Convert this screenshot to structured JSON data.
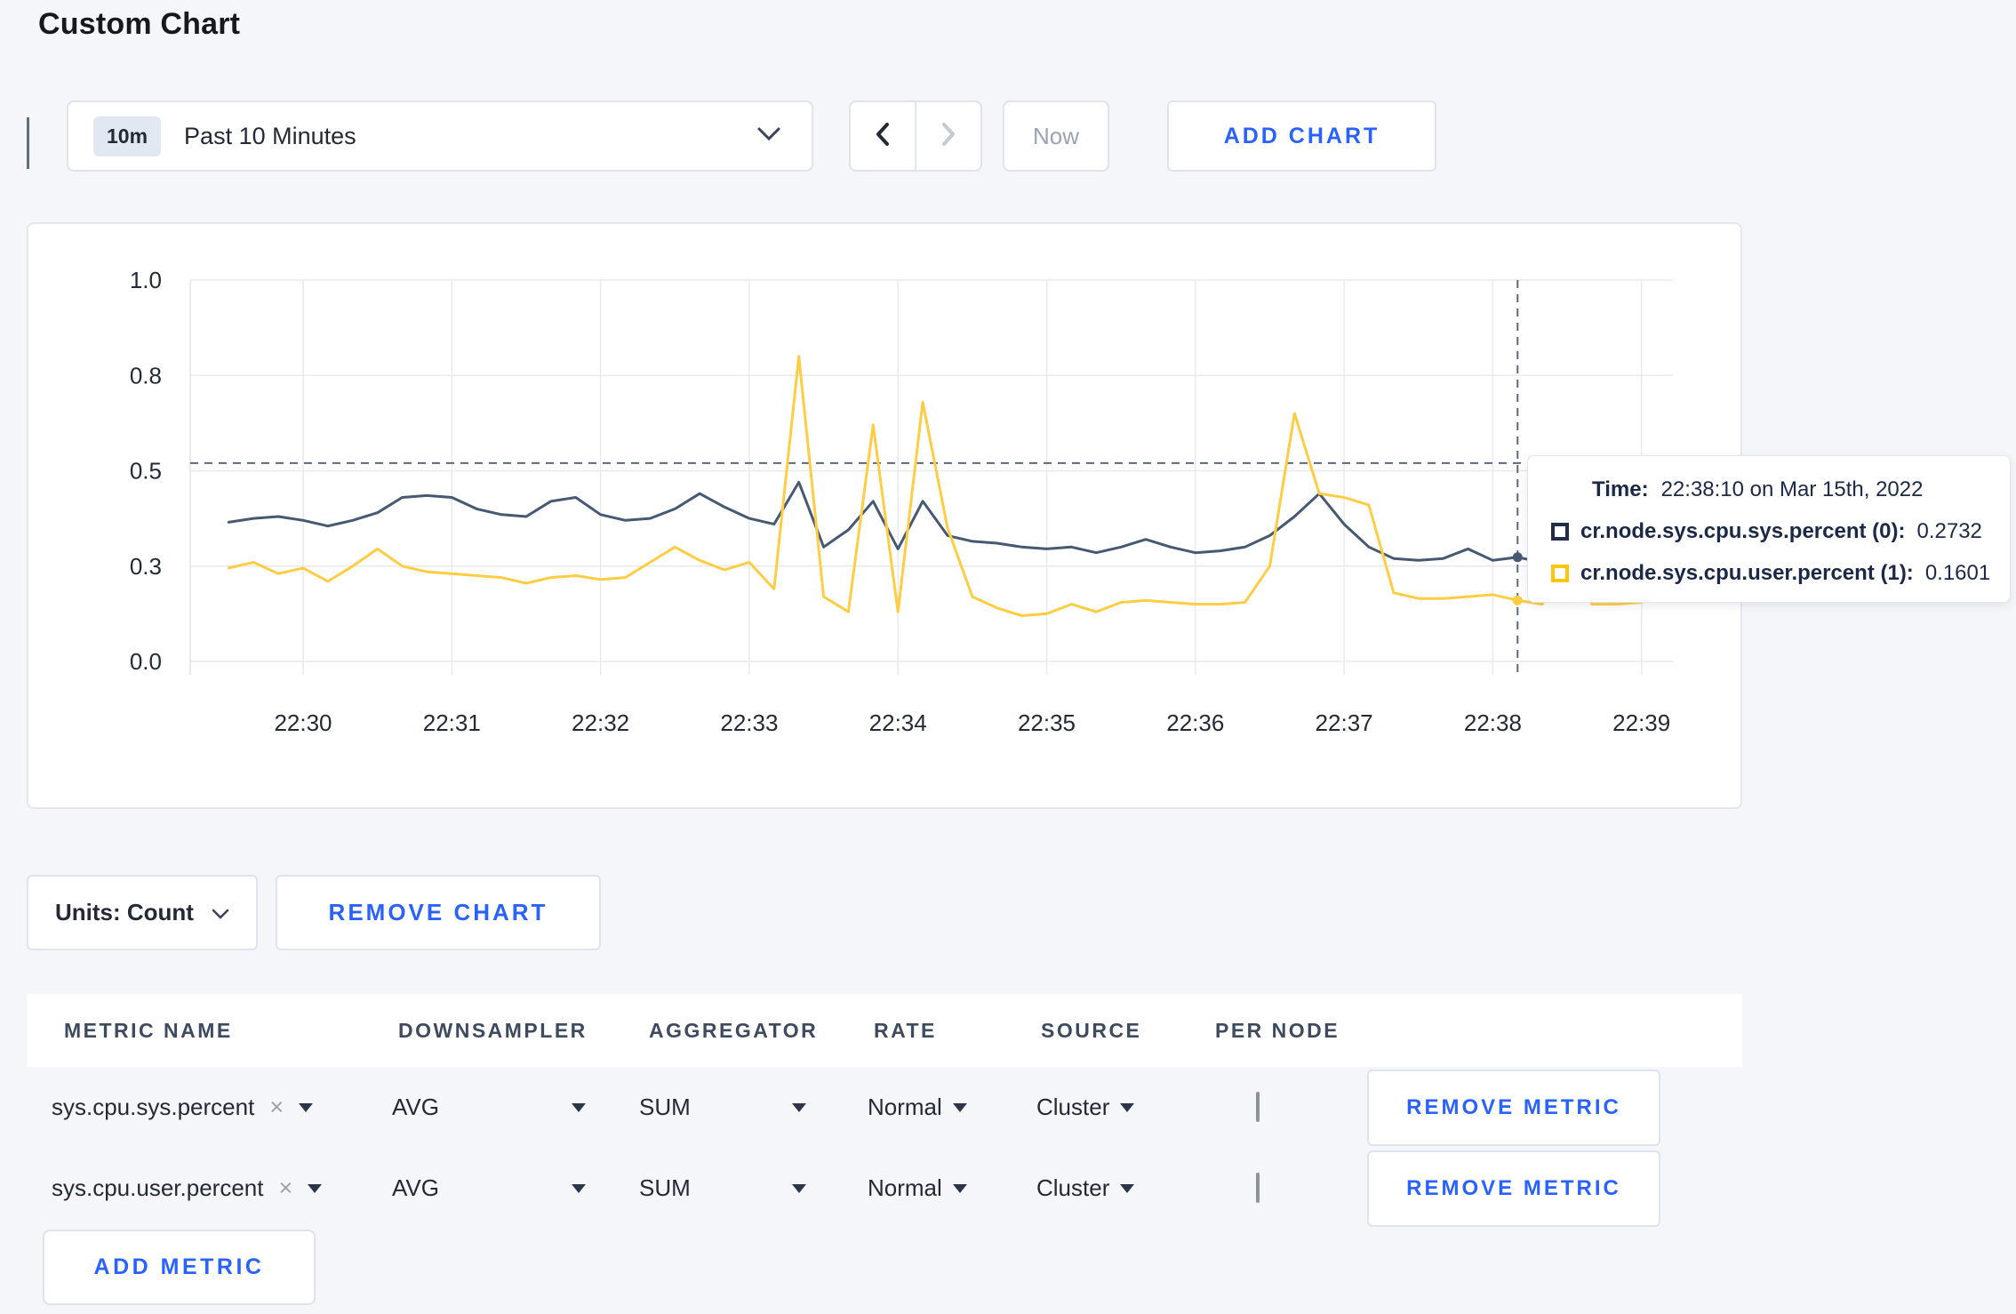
{
  "page": {
    "title": "Custom Chart"
  },
  "toolbar": {
    "time_selector": {
      "badge": "10m",
      "selected": "Past 10 Minutes"
    },
    "now_button": "Now",
    "add_chart_button": "ADD CHART"
  },
  "chart_data": {
    "type": "line",
    "title": "",
    "xlabel": "",
    "ylabel": "",
    "ylim": [
      0,
      1
    ],
    "grid": true,
    "legend_position": "tooltip-only",
    "x_ticks": [
      "22:30",
      "22:31",
      "22:32",
      "22:33",
      "22:34",
      "22:35",
      "22:36",
      "22:37",
      "22:38",
      "22:39"
    ],
    "y_ticks": [
      {
        "label": "0.0",
        "value": 0
      },
      {
        "label": "0.3",
        "value": 0.25
      },
      {
        "label": "0.5",
        "value": 0.5
      },
      {
        "label": "0.8",
        "value": 0.75
      },
      {
        "label": "1.0",
        "value": 1
      }
    ],
    "x_start_offset_minutes": -0.5,
    "x_step_minutes": 0.1666667,
    "series": [
      {
        "name": "cr.node.sys.cpu.sys.percent (0)",
        "color": "#475872",
        "values": [
          0.365,
          0.375,
          0.38,
          0.37,
          0.355,
          0.37,
          0.39,
          0.43,
          0.435,
          0.43,
          0.4,
          0.385,
          0.38,
          0.42,
          0.43,
          0.385,
          0.37,
          0.375,
          0.4,
          0.44,
          0.405,
          0.375,
          0.36,
          0.47,
          0.3,
          0.345,
          0.42,
          0.295,
          0.42,
          0.33,
          0.315,
          0.31,
          0.3,
          0.295,
          0.3,
          0.285,
          0.3,
          0.32,
          0.3,
          0.285,
          0.29,
          0.3,
          0.33,
          0.38,
          0.44,
          0.36,
          0.3,
          0.27,
          0.265,
          0.27,
          0.295,
          0.265,
          0.2732,
          0.26,
          0.27,
          0.3,
          0.31,
          0.3,
          0.305
        ]
      },
      {
        "name": "cr.node.sys.cpu.user.percent (1)",
        "color": "#FFCD44",
        "values": [
          0.245,
          0.26,
          0.23,
          0.245,
          0.21,
          0.25,
          0.295,
          0.25,
          0.235,
          0.23,
          0.225,
          0.22,
          0.205,
          0.22,
          0.225,
          0.215,
          0.22,
          0.26,
          0.3,
          0.265,
          0.24,
          0.26,
          0.19,
          0.8,
          0.17,
          0.13,
          0.62,
          0.13,
          0.68,
          0.35,
          0.17,
          0.14,
          0.12,
          0.125,
          0.15,
          0.13,
          0.155,
          0.16,
          0.155,
          0.15,
          0.15,
          0.155,
          0.25,
          0.65,
          0.44,
          0.43,
          0.41,
          0.18,
          0.165,
          0.165,
          0.17,
          0.175,
          0.1601,
          0.15,
          0.33,
          0.15,
          0.15,
          0.155,
          0.27
        ]
      }
    ],
    "hover": {
      "index": 52,
      "time": "22:38:10",
      "crosshair_y_value": 0.52
    }
  },
  "tooltip": {
    "time_label": "Time:",
    "time_value": "22:38:10 on Mar 15th, 2022",
    "series": [
      {
        "swatch_color": "#222c4b",
        "label": "cr.node.sys.cpu.sys.percent (0):",
        "value": "0.2732"
      },
      {
        "swatch_color": "#ffc40c",
        "label": "cr.node.sys.cpu.user.percent (1):",
        "value": "0.1601"
      }
    ]
  },
  "chart_footer": {
    "units_button": "Units: Count",
    "remove_chart_button": "REMOVE CHART"
  },
  "metrics_table": {
    "headers": [
      "METRIC NAME",
      "DOWNSAMPLER",
      "AGGREGATOR",
      "RATE",
      "SOURCE",
      "PER NODE"
    ],
    "rows": [
      {
        "metric_name": "sys.cpu.sys.percent",
        "downsampler": "AVG",
        "aggregator": "SUM",
        "rate": "Normal",
        "source": "Cluster",
        "per_node_checked": false,
        "remove_button": "REMOVE METRIC"
      },
      {
        "metric_name": "sys.cpu.user.percent",
        "downsampler": "AVG",
        "aggregator": "SUM",
        "rate": "Normal",
        "source": "Cluster",
        "per_node_checked": false,
        "remove_button": "REMOVE METRIC"
      }
    ],
    "add_metric_button": "ADD METRIC"
  },
  "colors": {
    "accent_blue": "#2962ff",
    "page_bg": "#f5f6fa",
    "series_sys": "#475872",
    "series_user": "#FFCD44"
  }
}
